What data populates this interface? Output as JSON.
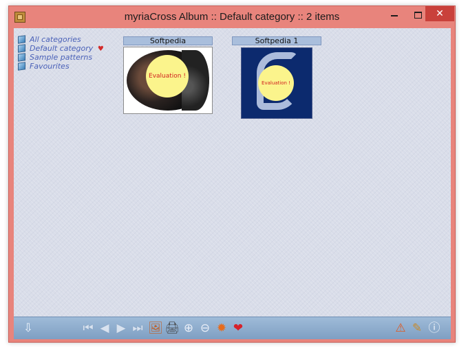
{
  "window": {
    "title": "myriaCross Album :: Default category :: 2 items",
    "buttons": {
      "minimize": "",
      "maximize": "",
      "close": "✕"
    }
  },
  "categories": [
    {
      "label": "All categories",
      "favourite": false
    },
    {
      "label": "Default category",
      "favourite": true
    },
    {
      "label": "Sample patterns",
      "favourite": false
    },
    {
      "label": "Favourites",
      "favourite": false
    }
  ],
  "heart_glyph": "♥",
  "thumbnails": [
    {
      "label": "Softpedia",
      "overlay": "Evaluation !"
    },
    {
      "label": "Softpedia 1",
      "overlay": "Evaluation !"
    }
  ],
  "toolbar": {
    "down": "⇩",
    "first": "⏮",
    "prev": "◀",
    "next": "▶",
    "last": "⏭",
    "add_image": "🖼",
    "print": "🖨",
    "zoom_in": "⊕",
    "zoom_out": "⊖",
    "settings": "✹",
    "favourite": "❤",
    "warning": "⚠",
    "clean": "✎",
    "info": "ⓘ"
  },
  "colors": {
    "frame": "#e8847c",
    "close": "#c9413b",
    "client_bg": "#d9dde9",
    "link": "#4a61b8",
    "label_bg": "#a9bedc",
    "toolbar": "#8fabd0",
    "overlay_fill": "#fbf48c",
    "overlay_text": "#d01d1d"
  }
}
